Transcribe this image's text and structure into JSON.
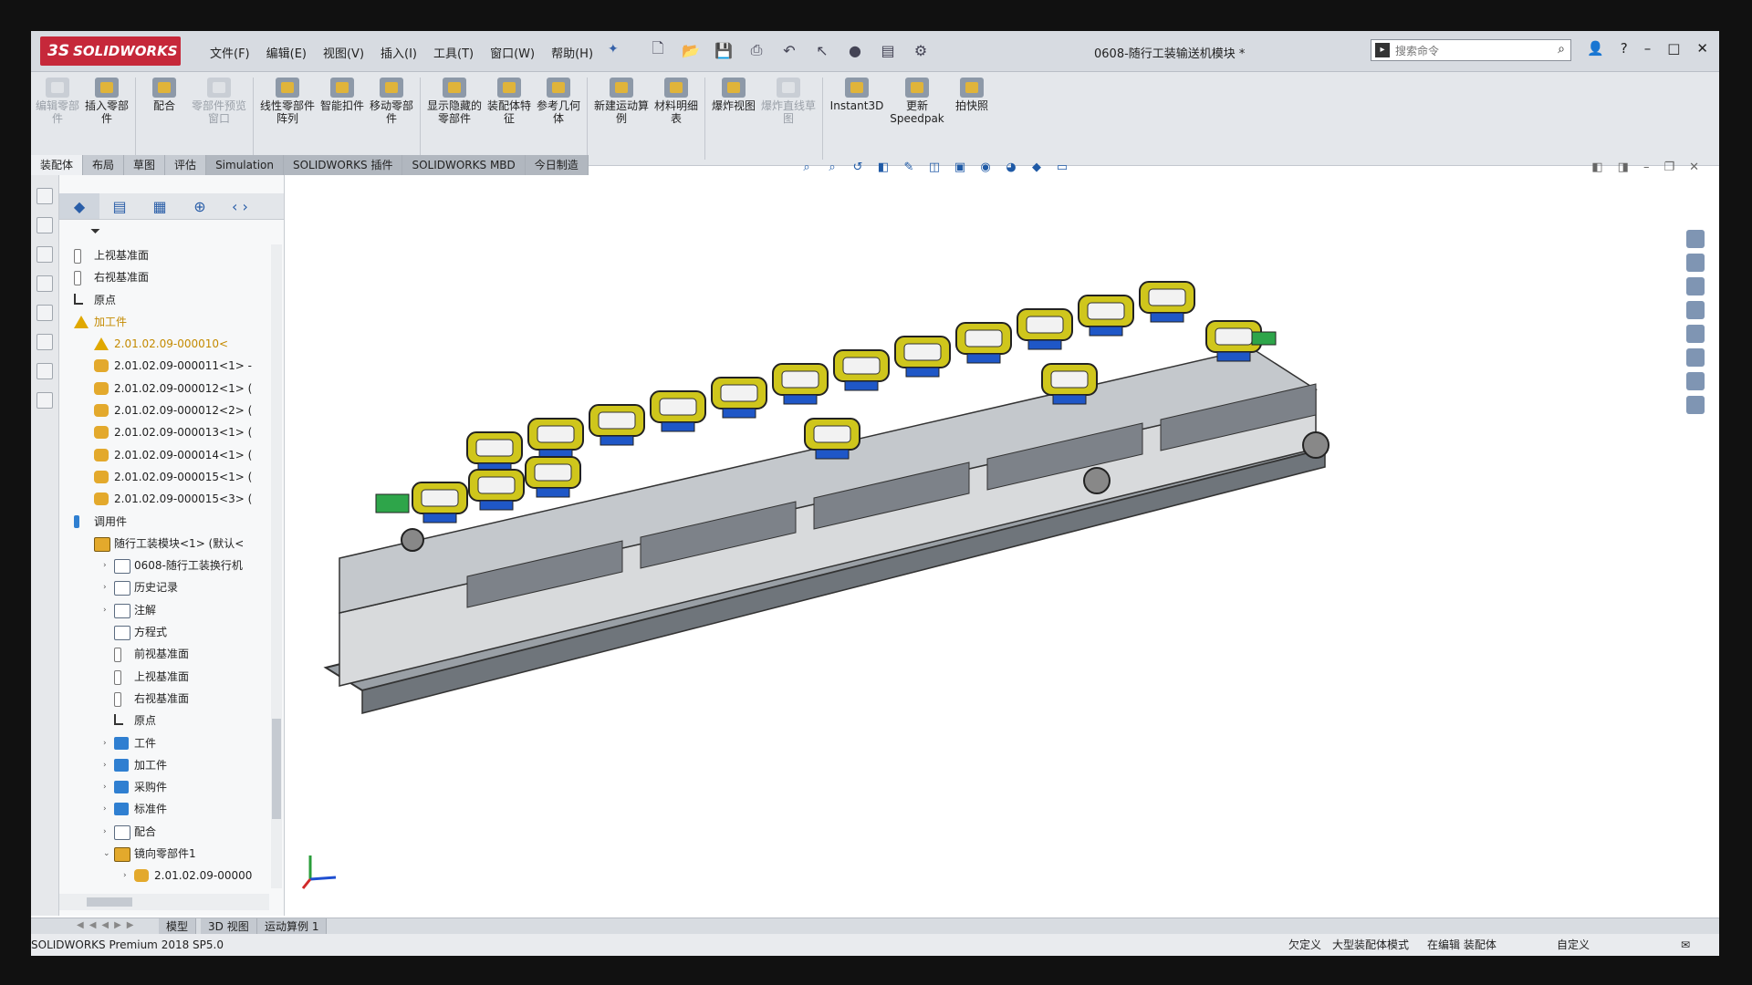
{
  "titlebar": {
    "logo_text": "SOLIDWORKS",
    "logo_mark": "3S",
    "menus": [
      "文件(F)",
      "编辑(E)",
      "视图(V)",
      "插入(I)",
      "工具(T)",
      "窗口(W)",
      "帮助(H)"
    ],
    "document_title": "0608-随行工装输送机模块 *",
    "search_placeholder": "搜索命令"
  },
  "commands": [
    {
      "label": "编辑零部件",
      "disabled": true
    },
    {
      "label": "插入零部件",
      "disabled": false
    },
    {
      "label": "配合",
      "disabled": false
    },
    {
      "label": "零部件预览窗口",
      "disabled": true
    },
    {
      "label": "线性零部件阵列",
      "disabled": false
    },
    {
      "label": "智能扣件",
      "disabled": false
    },
    {
      "label": "移动零部件",
      "disabled": false
    },
    {
      "label": "显示隐藏的零部件",
      "disabled": false
    },
    {
      "label": "装配体特征",
      "disabled": false
    },
    {
      "label": "参考几何体",
      "disabled": false
    },
    {
      "label": "新建运动算例",
      "disabled": false
    },
    {
      "label": "材料明细表",
      "disabled": false
    },
    {
      "label": "爆炸视图",
      "disabled": false
    },
    {
      "label": "爆炸直线草图",
      "disabled": true
    },
    {
      "label": "Instant3D",
      "disabled": false
    },
    {
      "label": "更新 Speedpak",
      "disabled": false
    },
    {
      "label": "拍快照",
      "disabled": false
    }
  ],
  "tabs": [
    "装配体",
    "布局",
    "草图",
    "评估",
    "Simulation",
    "SOLIDWORKS 插件",
    "SOLIDWORKS MBD",
    "今日制造"
  ],
  "tree": [
    {
      "label": "上视基准面",
      "icon": "plane",
      "indent": 0,
      "toggle": ""
    },
    {
      "label": "右视基准面",
      "icon": "plane",
      "indent": 0,
      "toggle": ""
    },
    {
      "label": "原点",
      "icon": "origin",
      "indent": 0,
      "toggle": ""
    },
    {
      "label": "加工件",
      "icon": "warn",
      "indent": 0,
      "toggle": "",
      "color": "yellow"
    },
    {
      "label": "2.01.02.09-000010<",
      "icon": "warn",
      "indent": 1,
      "toggle": "",
      "color": "yellow"
    },
    {
      "label": "2.01.02.09-000011<1> -",
      "icon": "part",
      "indent": 1,
      "toggle": ""
    },
    {
      "label": "2.01.02.09-000012<1> (",
      "icon": "part",
      "indent": 1,
      "toggle": ""
    },
    {
      "label": "2.01.02.09-000012<2> (",
      "icon": "part",
      "indent": 1,
      "toggle": ""
    },
    {
      "label": "2.01.02.09-000013<1> (",
      "icon": "part",
      "indent": 1,
      "toggle": ""
    },
    {
      "label": "2.01.02.09-000014<1> (",
      "icon": "part",
      "indent": 1,
      "toggle": ""
    },
    {
      "label": "2.01.02.09-000015<1> (",
      "icon": "part",
      "indent": 1,
      "toggle": ""
    },
    {
      "label": "2.01.02.09-000015<3> (",
      "icon": "part",
      "indent": 1,
      "toggle": ""
    },
    {
      "label": "调用件",
      "icon": "blue",
      "indent": 0,
      "toggle": ""
    },
    {
      "label": "随行工装模块<1> (默认<",
      "icon": "assy",
      "indent": 1,
      "toggle": ""
    },
    {
      "label": "0608-随行工装换行机",
      "icon": "doc",
      "indent": 2,
      "toggle": "›"
    },
    {
      "label": "历史记录",
      "icon": "doc",
      "indent": 2,
      "toggle": "›"
    },
    {
      "label": "注解",
      "icon": "doc",
      "indent": 2,
      "toggle": "›"
    },
    {
      "label": "方程式",
      "icon": "doc",
      "indent": 2,
      "toggle": ""
    },
    {
      "label": "前视基准面",
      "icon": "plane",
      "indent": 2,
      "toggle": ""
    },
    {
      "label": "上视基准面",
      "icon": "plane",
      "indent": 2,
      "toggle": ""
    },
    {
      "label": "右视基准面",
      "icon": "plane",
      "indent": 2,
      "toggle": ""
    },
    {
      "label": "原点",
      "icon": "origin",
      "indent": 2,
      "toggle": ""
    },
    {
      "label": "工件",
      "icon": "folder",
      "indent": 2,
      "toggle": "›"
    },
    {
      "label": "加工件",
      "icon": "folder",
      "indent": 2,
      "toggle": "›"
    },
    {
      "label": "采购件",
      "icon": "folder",
      "indent": 2,
      "toggle": "›"
    },
    {
      "label": "标准件",
      "icon": "folder",
      "indent": 2,
      "toggle": "›"
    },
    {
      "label": "配合",
      "icon": "doc",
      "indent": 2,
      "toggle": "›"
    },
    {
      "label": "镜向零部件1",
      "icon": "assy",
      "indent": 2,
      "toggle": "⌄"
    },
    {
      "label": "2.01.02.09-00000",
      "icon": "part",
      "indent": 3,
      "toggle": "›"
    }
  ],
  "bottom_tabs": [
    "模型",
    "3D 视图",
    "运动算例 1"
  ],
  "status": {
    "product": "SOLIDWORKS Premium 2018 SP5.0",
    "state1": "欠定义",
    "state2": "大型装配体模式",
    "state3": "在编辑 装配体",
    "units": "自定义"
  },
  "colors": {
    "brand": "#c6283a",
    "fixture_yellow": "#c9c21a",
    "accent_blue": "#1f5aa6"
  }
}
